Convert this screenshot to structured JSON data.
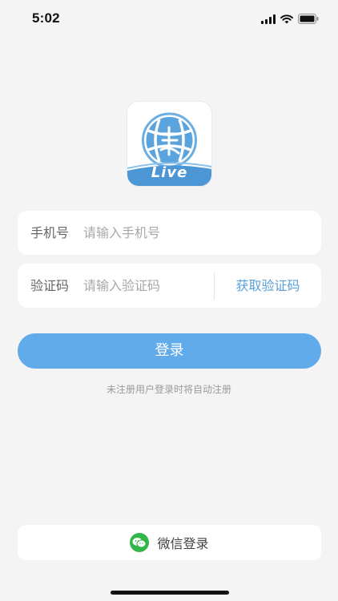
{
  "status_bar": {
    "time": "5:02"
  },
  "logo": {
    "tagline": "Live",
    "icon": "basketball-logo-icon",
    "colors": {
      "blue": "#5aa3dd",
      "light_blue": "#8fc1ea"
    }
  },
  "form": {
    "phone": {
      "label": "手机号",
      "placeholder": "请输入手机号",
      "value": ""
    },
    "code": {
      "label": "验证码",
      "placeholder": "请输入验证码",
      "value": "",
      "get_code_label": "获取验证码"
    },
    "login_label": "登录",
    "hint": "未注册用户登录时将自动注册"
  },
  "wechat": {
    "label": "微信登录",
    "icon": "wechat-icon",
    "color": "#32b54a"
  },
  "colors": {
    "accent": "#62abeb",
    "link": "#5a9fd8",
    "background": "#f4f4f4"
  }
}
